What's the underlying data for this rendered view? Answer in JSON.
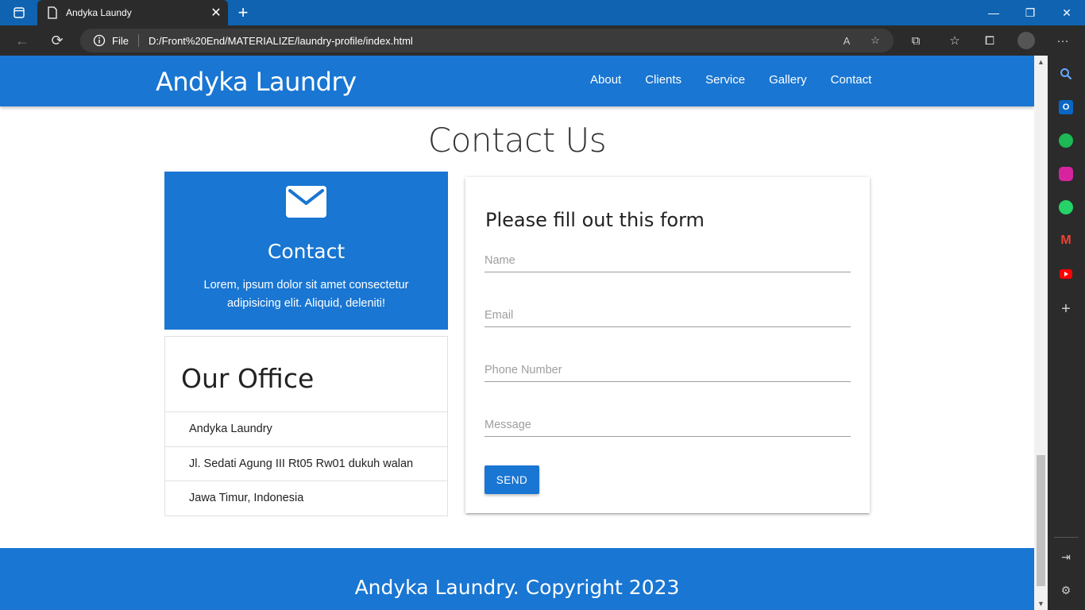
{
  "browser": {
    "tab_title": "Andyka Laundy",
    "omnibox_file_label": "File",
    "url": "D:/Front%20End/MATERIALIZE/laundry-profile/index.html"
  },
  "navbar": {
    "brand": "Andyka Laundry",
    "links": [
      "About",
      "Clients",
      "Service",
      "Gallery",
      "Contact"
    ]
  },
  "section": {
    "title": "Contact Us"
  },
  "contact_card": {
    "title": "Contact",
    "text": "Lorem, ipsum dolor sit amet consectetur adipisicing elit. Aliquid, deleniti!"
  },
  "office": {
    "title": "Our Office",
    "rows": [
      "Andyka Laundry",
      "Jl. Sedati Agung III Rt05 Rw01 dukuh walan",
      "Jawa Timur, Indonesia"
    ]
  },
  "form": {
    "title": "Please fill out this form",
    "name_placeholder": "Name",
    "email_placeholder": "Email",
    "phone_placeholder": "Phone Number",
    "message_placeholder": "Message",
    "send_label": "SEND"
  },
  "footer": {
    "text": "Andyka Laundry. Copyright 2023"
  },
  "colors": {
    "primary": "#1976d2",
    "tabbar": "#0f63b0",
    "chrome_dark": "#2b2b2b"
  }
}
